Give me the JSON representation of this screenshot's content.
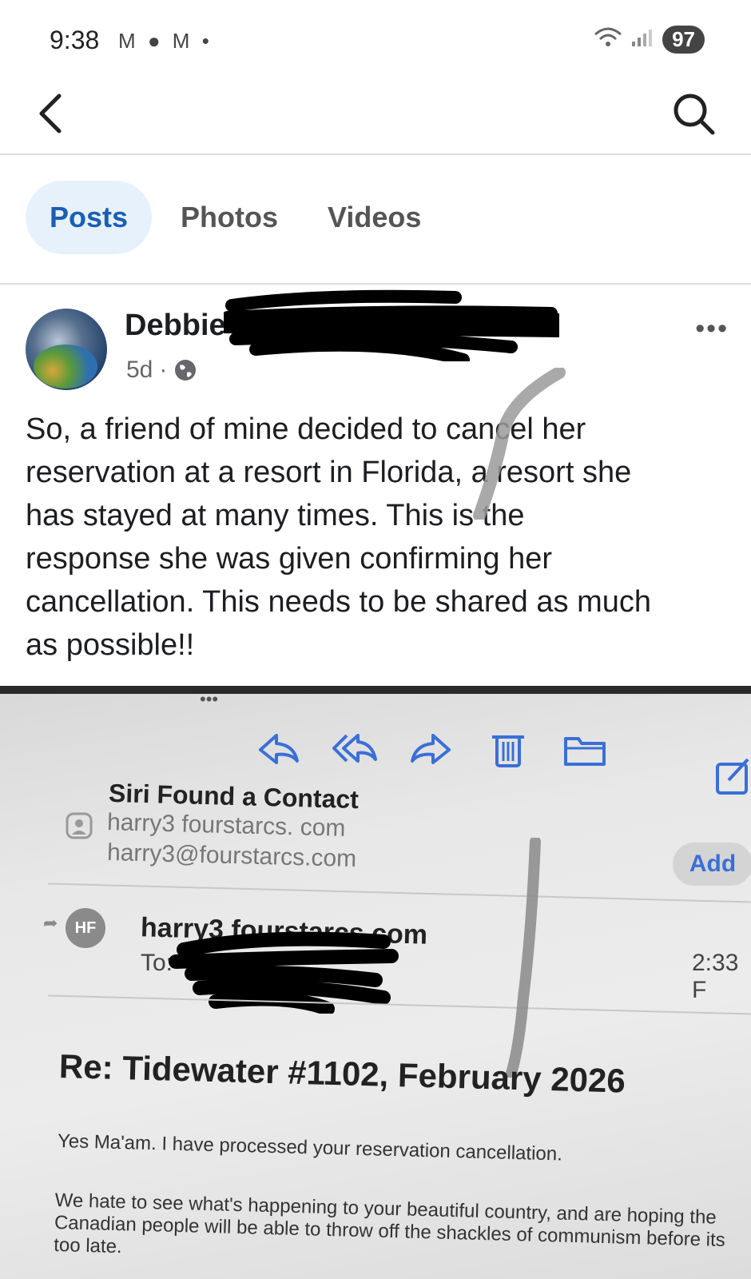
{
  "status_bar": {
    "time": "9:38",
    "notification_icons": "M ● M •",
    "wifi_icon": "wifi-icon",
    "signal_icon": "signal-icon",
    "battery": "97"
  },
  "nav": {
    "back_icon": "back-chevron-icon",
    "search_icon": "search-icon"
  },
  "tabs": [
    {
      "label": "Posts",
      "active": true
    },
    {
      "label": "Photos",
      "active": false
    },
    {
      "label": "Videos",
      "active": false
    }
  ],
  "post": {
    "author": "Debbie",
    "age": "5d",
    "privacy_icon": "globe-icon",
    "more_icon": "more-horizontal-icon",
    "text_lines": [
      "So, a friend of mine decided to cancel her",
      "reservation at a resort in Florida, a resort she",
      "has stayed at many times.  This is the",
      "response she was given confirming her",
      "cancellation.  This needs to be shared as much",
      "as possible!!"
    ]
  },
  "photo": {
    "toolbar_icons": [
      "reply-icon",
      "reply-all-icon",
      "forward-icon",
      "trash-icon",
      "folder-icon"
    ],
    "compose_icon": "compose-icon",
    "siri_title": "Siri Found a Contact",
    "siri_name": "harry3 fourstarcs. com",
    "siri_email": "harry3@fourstarcs.com",
    "add_label": "Add",
    "sender_initials": "HF",
    "sender": "harry3 fourstarcs.com",
    "to_label": "To:",
    "time": "2:33 F",
    "subject": "Re: Tidewater #1102, February 2026",
    "body_line1": "Yes Ma'am. I have processed your reservation cancellation.",
    "body_line2": "We hate to see what's happening to your beautiful country, and are hoping the Canadian people will be able to throw off the shackles of communism before its too late."
  },
  "colors": {
    "accent_blue": "#1a5fb4",
    "active_tab_bg": "#e7f1fb",
    "ios_blue": "#3a6fd8"
  }
}
